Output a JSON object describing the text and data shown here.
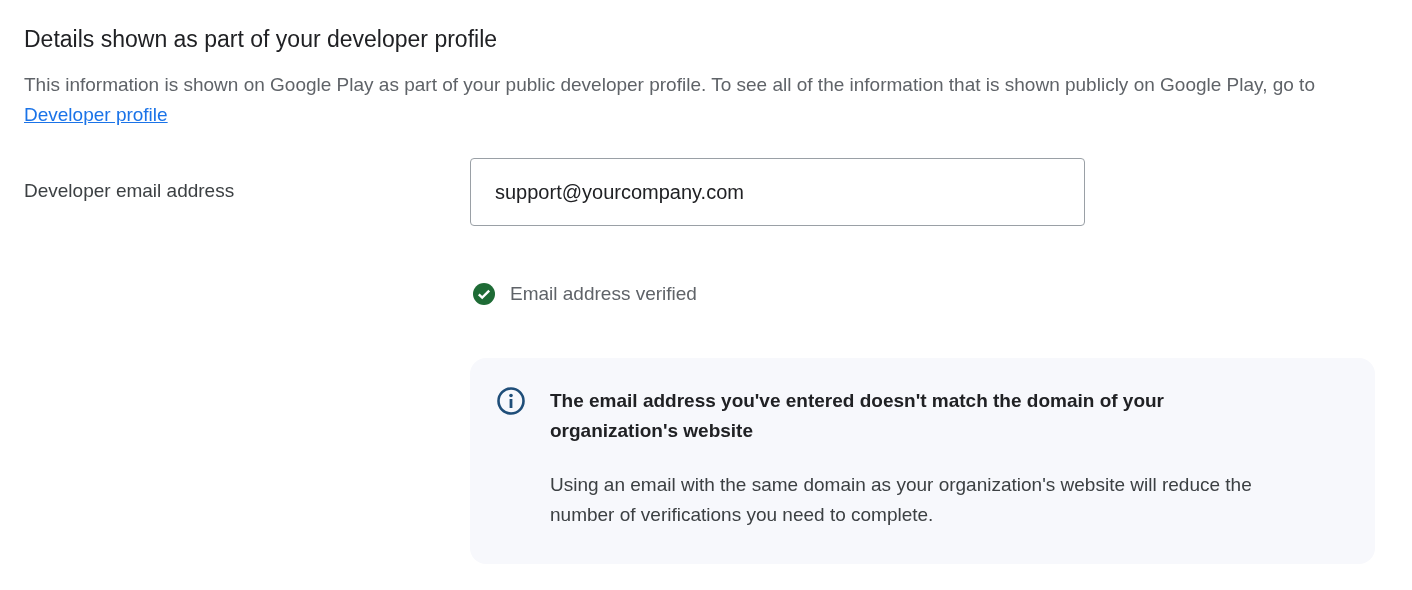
{
  "section": {
    "title": "Details shown as part of your developer profile",
    "description": "This information is shown on Google Play as part of your public developer profile. To see all of the information that is shown publicly on Google Play, go to",
    "link": "Developer profile"
  },
  "email_field": {
    "label": "Developer email address",
    "value": "support@yourcompany.com",
    "verified": true,
    "status": "Email address verified"
  },
  "notice": {
    "kind": "info",
    "title": "The email address you've entered doesn't match the domain of your organization's website",
    "body": "Using an email with the same domain as your organization's website will reduce the number of verifications you need to complete."
  }
}
